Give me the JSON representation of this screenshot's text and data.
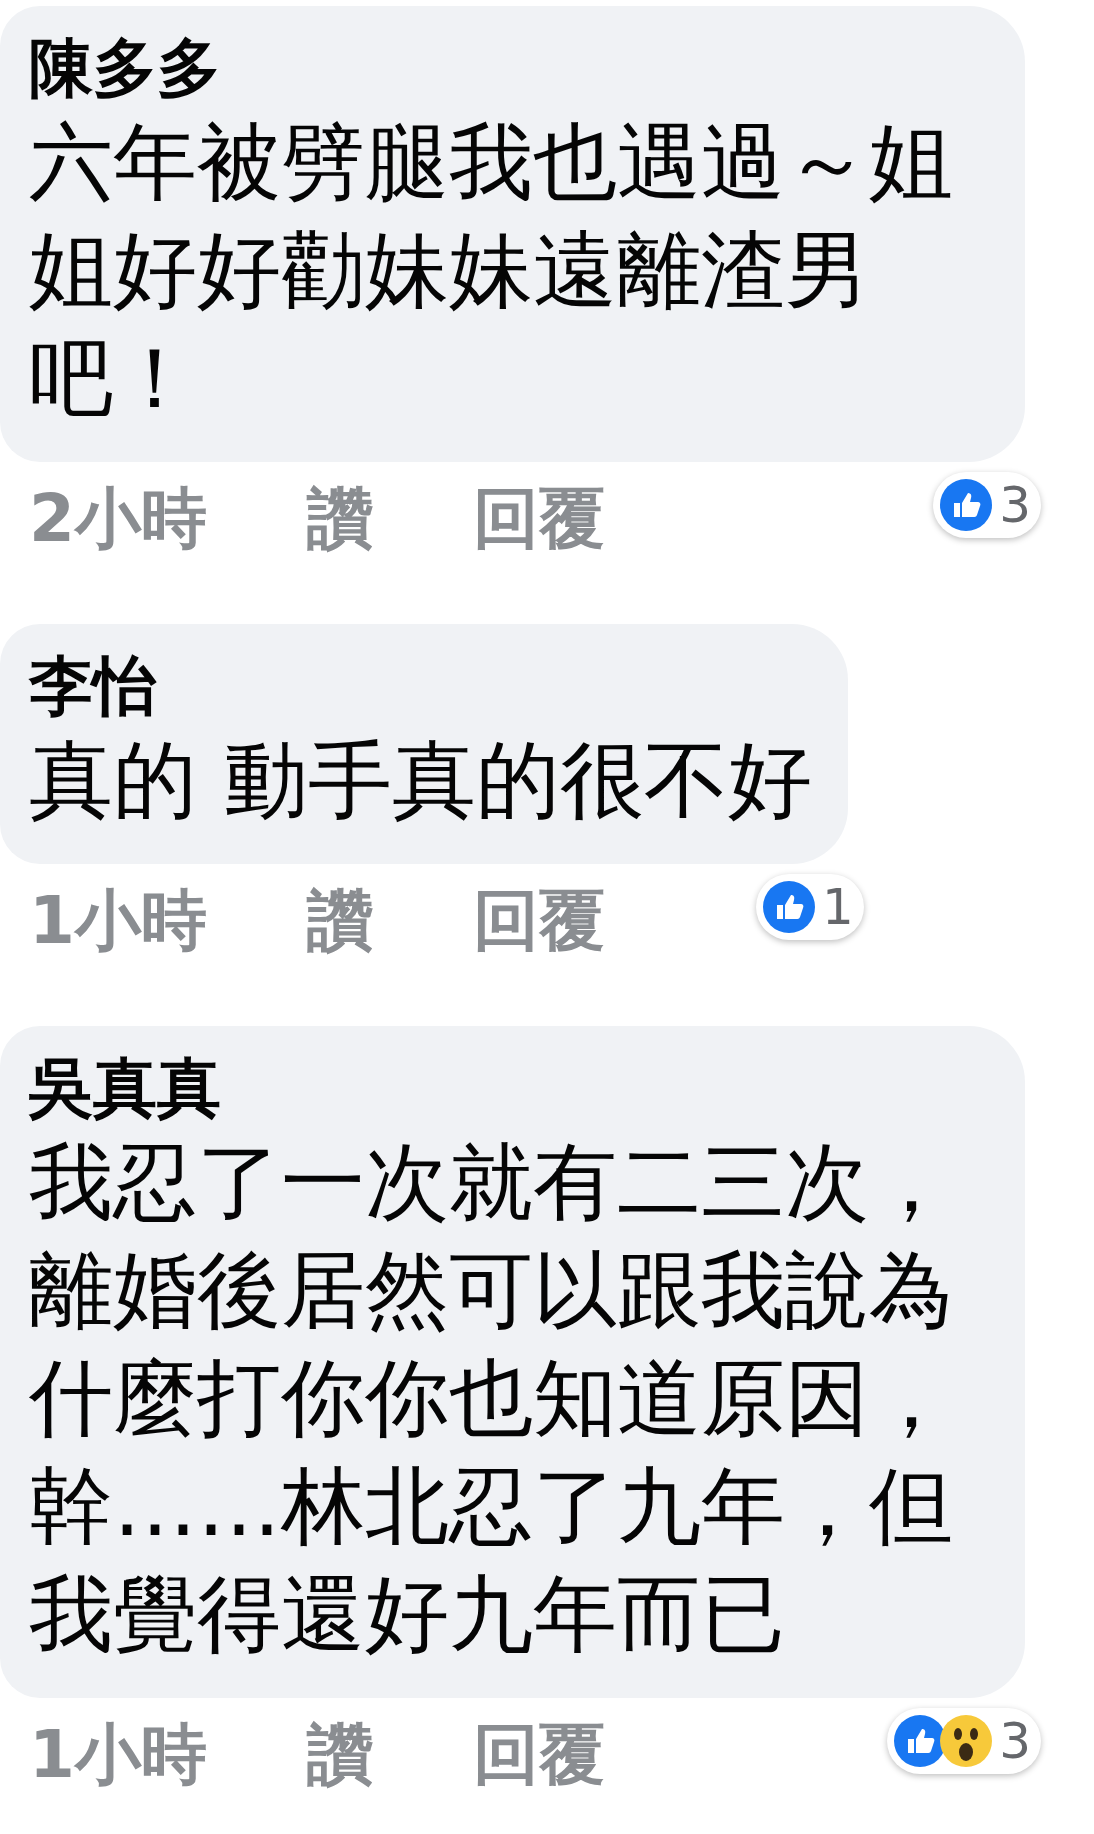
{
  "comments": [
    {
      "author": "陳多多",
      "text": "六年被劈腿我也遇過～姐姐好好勸妹妹遠離渣男吧！",
      "time": "2小時",
      "like": "讚",
      "reply": "回覆",
      "reactions": [
        {
          "kind": "like"
        }
      ],
      "reaction_count": "3"
    },
    {
      "author": "李怡",
      "text": "真的 動手真的很不好",
      "time": "1小時",
      "like": "讚",
      "reply": "回覆",
      "reactions": [
        {
          "kind": "like"
        }
      ],
      "reaction_count": "1"
    },
    {
      "author": "吳真真",
      "text": "我忍了一次就有二三次，離婚後居然可以跟我說為什麼打你你也知道原因，幹……林北忍了九年，但我覺得還好九年而已",
      "time": "1小時",
      "like": "讚",
      "reply": "回覆",
      "reactions": [
        {
          "kind": "like"
        },
        {
          "kind": "wow"
        }
      ],
      "reaction_count": "3"
    }
  ]
}
